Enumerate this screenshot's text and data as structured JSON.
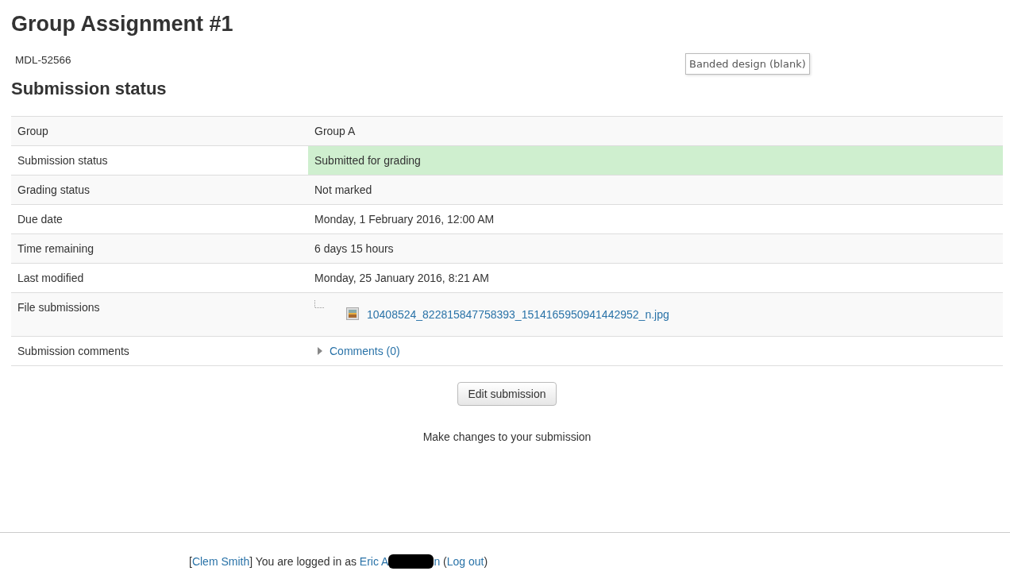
{
  "title": "Group Assignment #1",
  "intro": "MDL-52566",
  "tooltip": "Banded design (blank)",
  "section_title": "Submission status",
  "rows": [
    {
      "kind": "text",
      "label": "Group",
      "value": "Group A"
    },
    {
      "kind": "status",
      "label": "Submission status",
      "value": "Submitted for grading",
      "color": "#cfefcf"
    },
    {
      "kind": "text",
      "label": "Grading status",
      "value": "Not marked"
    },
    {
      "kind": "text",
      "label": "Due date",
      "value": "Monday, 1 February 2016, 12:00 AM"
    },
    {
      "kind": "text",
      "label": "Time remaining",
      "value": "6 days 15 hours"
    },
    {
      "kind": "text",
      "label": "Last modified",
      "value": "Monday, 25 January 2016, 8:21 AM"
    },
    {
      "kind": "file",
      "label": "File submissions",
      "value": "10408524_822815847758393_1514165950941442952_n.jpg"
    },
    {
      "kind": "comments",
      "label": "Submission comments",
      "value": "Comments (0)",
      "expanded": false
    }
  ],
  "button": "Edit submission",
  "button_hint": "Make changes to your submission",
  "footer": {
    "open_bracket": "[",
    "real_user": "Clem Smith",
    "text": "] You are logged in as",
    "user_name": "Eric A",
    "user_name_end": "n",
    "logout_open": "(",
    "logout": "Log out",
    "logout_close": ")"
  }
}
